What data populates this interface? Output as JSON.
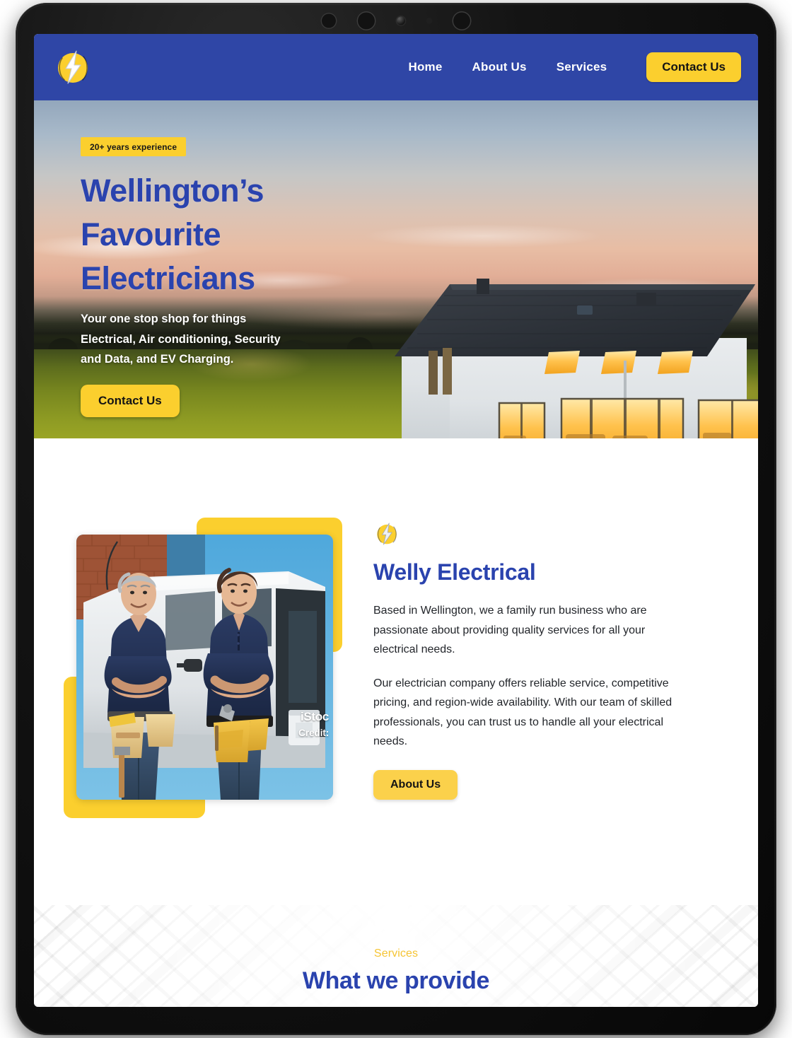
{
  "device": {
    "type": "tablet",
    "sensors": [
      "bezel-ring-icon",
      "bezel-ring-icon",
      "camera-lens-icon",
      "ambient-sensor-icon",
      "bezel-ring-icon"
    ]
  },
  "colors": {
    "brand_blue": "#2F46A6",
    "heading_blue": "#2A43AE",
    "accent_yellow": "#FBCF2E",
    "button_yellow": "#FBD14B",
    "eyebrow_yellow": "#F5C433",
    "body_text": "#23262b",
    "white": "#ffffff",
    "bezel_black": "#141414"
  },
  "navbar": {
    "logo_name": "lightning-bolt-logo",
    "links": [
      {
        "label": "Home"
      },
      {
        "label": "About Us"
      },
      {
        "label": "Services"
      }
    ],
    "cta_label": "Contact Us"
  },
  "hero": {
    "badge": "20+ years experience",
    "title_lines": [
      "Wellington’s",
      "Favourite",
      "Electricians"
    ],
    "subtitle": "Your one stop shop for things Electrical, Air conditioning, Security and Data, and EV Charging.",
    "cta_label": "Contact Us",
    "image_alt": "modern-house-at-dusk-with-lit-windows"
  },
  "about": {
    "icon_name": "lightning-bolt-icon",
    "heading": "Welly Electrical",
    "paragraphs": [
      "Based in Wellington, we a family run business who are passionate about providing quality services for all your electrical needs.",
      "Our electrician company offers reliable service, competitive pricing, and region-wide availability. With our team of skilled professionals, you can trust us to handle all your electrical needs."
    ],
    "cta_label": "About Us",
    "photo_alt": "two-electricians-standing-in-front-of-white-van",
    "photo_watermark_line1": "iStoc",
    "photo_watermark_line2": "Credit:"
  },
  "services": {
    "eyebrow": "Services",
    "heading": "What we provide"
  }
}
